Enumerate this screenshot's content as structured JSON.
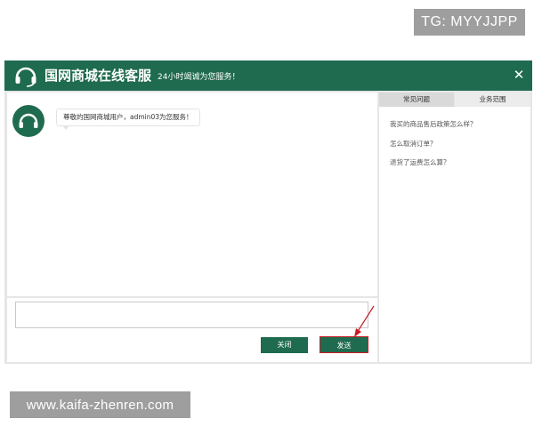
{
  "overlay": {
    "tg_label": "TG: MYYJJPP",
    "watermark": "www.kaifa-zhenren.com"
  },
  "header": {
    "title": "国网商城在线客服",
    "subtitle": "24小时竭诚为您服务！",
    "close_symbol": "✕",
    "logo_icon": "headset-icon"
  },
  "chat": {
    "messages": [
      {
        "sender": "agent",
        "avatar_icon": "headset-icon",
        "text": "尊敬的国网商城用户，admin03为您服务！"
      }
    ]
  },
  "composer": {
    "input_value": "",
    "close_label": "关闭",
    "send_label": "发送"
  },
  "sidebar": {
    "tabs": [
      {
        "label": "常见问题",
        "active": true
      },
      {
        "label": "业务范围",
        "active": false
      }
    ],
    "faq": [
      "我买的商品售后政策怎么样？",
      "怎么取消订单？",
      "退货了运费怎么算？"
    ]
  },
  "colors": {
    "brand_green": "#1f6b4f",
    "highlight_red": "#c81d25",
    "panel_gray": "#e6e6e6"
  }
}
